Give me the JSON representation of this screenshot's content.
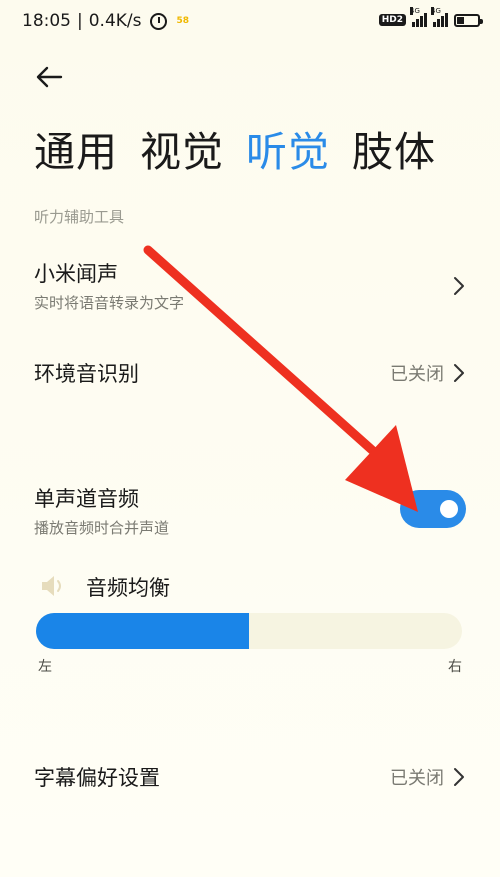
{
  "status_bar": {
    "time": "18:05",
    "network_speed": "0.4K/s",
    "app_badge": "58",
    "hd_label": "HD2",
    "network_type_1": "4G",
    "network_type_2": "4G"
  },
  "header": {
    "back_icon": "back-arrow-icon"
  },
  "tabs": [
    {
      "label": "通用",
      "active": false
    },
    {
      "label": "视觉",
      "active": false
    },
    {
      "label": "听觉",
      "active": true
    },
    {
      "label": "肢体",
      "active": false
    }
  ],
  "section": {
    "title": "听力辅助工具"
  },
  "settings": {
    "xiaomi_wensheng": {
      "title": "小米闻声",
      "subtitle": "实时将语音转录为文字"
    },
    "ambient_sound": {
      "title": "环境音识别",
      "value": "已关闭"
    },
    "mono_audio": {
      "title": "单声道音频",
      "subtitle": "播放音频时合并声道",
      "enabled": true
    },
    "audio_balance": {
      "title": "音频均衡",
      "left_label": "左",
      "right_label": "右",
      "level": 0.5
    },
    "caption_prefs": {
      "title": "字幕偏好设置",
      "value": "已关闭"
    }
  },
  "colors": {
    "accent": "#2a8be8",
    "annotation_arrow": "#ee3020",
    "background": "#fefdf2"
  }
}
